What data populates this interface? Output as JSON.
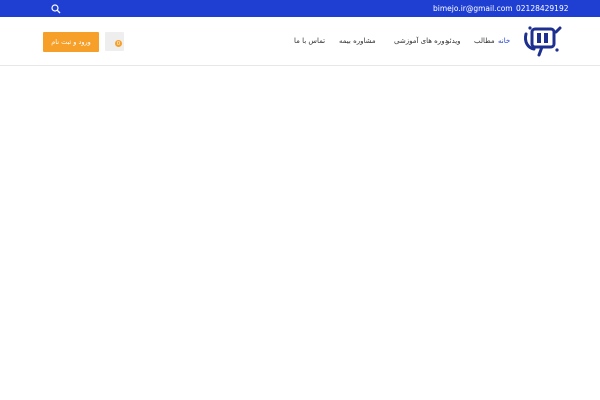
{
  "topbar": {
    "phone": "02128429192",
    "email": "bimejo.ir@gmail.com"
  },
  "header": {
    "login_label": "ورود و ثبت نام",
    "cart_count": "0"
  },
  "nav": {
    "items": [
      {
        "label": "خانه",
        "active": true
      },
      {
        "label": "مطالب"
      },
      {
        "label": "ویدئو"
      },
      {
        "label": "دوره های آموزشی"
      },
      {
        "label": "مشاوره بیمه"
      },
      {
        "label": "تماس با ما"
      }
    ]
  },
  "colors": {
    "topbar": "#1f3fd3",
    "accent": "#f6a02a",
    "active_nav": "#1f3fd3",
    "logo": "#1d2f8f"
  },
  "icons": {
    "search": "search-icon",
    "cart": "cart-icon",
    "logo": "site-logo"
  }
}
